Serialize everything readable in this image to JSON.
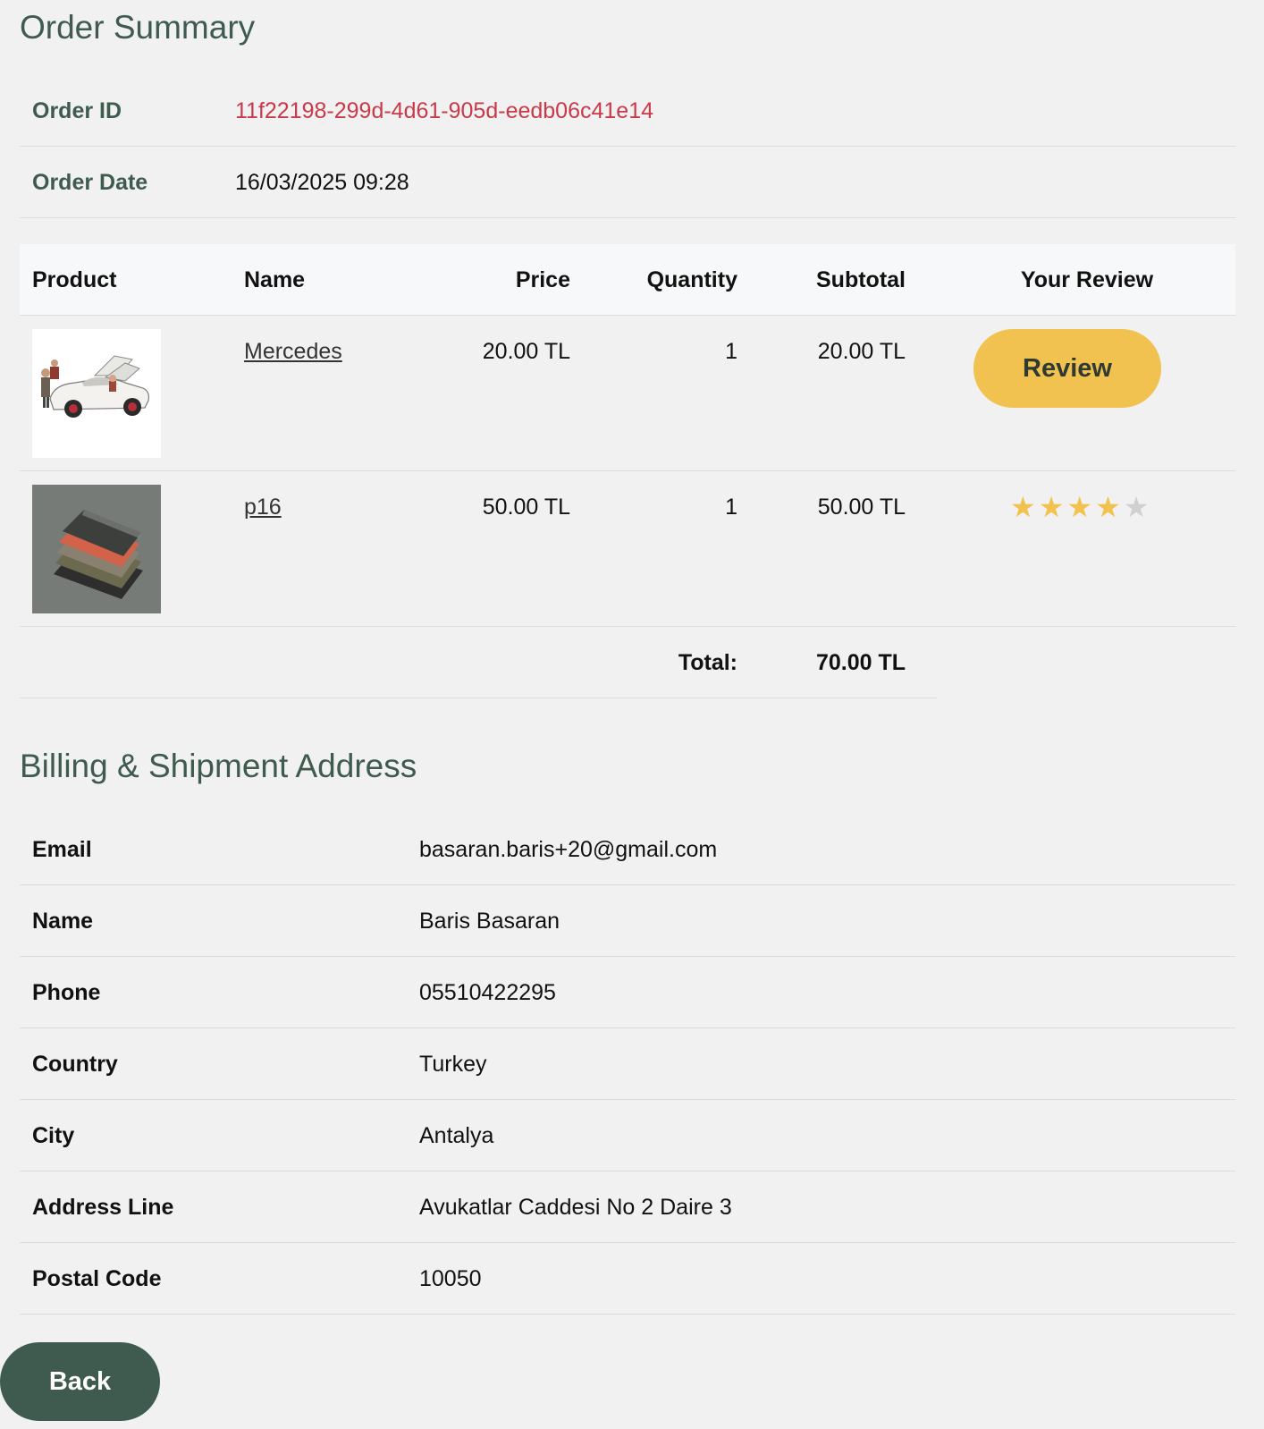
{
  "order_summary": {
    "title": "Order Summary",
    "order_id_label": "Order ID",
    "order_id": "11f22198-299d-4d61-905d-eedb06c41e14",
    "order_date_label": "Order Date",
    "order_date": "16/03/2025 09:28"
  },
  "products_table": {
    "headers": [
      "Product",
      "Name",
      "Price",
      "Quantity",
      "Subtotal",
      "Your Review"
    ],
    "rows": [
      {
        "image": "toy-car-image",
        "name": "Mercedes",
        "price": "20.00 TL",
        "quantity": "1",
        "subtotal": "20.00 TL",
        "review_button": "Review"
      },
      {
        "image": "stacked-wallets-image",
        "name": "p16",
        "price": "50.00 TL",
        "quantity": "1",
        "subtotal": "50.00 TL",
        "rating": 4,
        "rating_max": 5
      }
    ],
    "total_label": "Total:",
    "total_value": "70.00 TL"
  },
  "billing": {
    "title": "Billing & Shipment Address",
    "rows": [
      {
        "label": "Email",
        "value": "basaran.baris+20@gmail.com"
      },
      {
        "label": "Name",
        "value": "Baris Basaran"
      },
      {
        "label": "Phone",
        "value": "05510422295"
      },
      {
        "label": "Country",
        "value": "Turkey"
      },
      {
        "label": "City",
        "value": "Antalya"
      },
      {
        "label": "Address Line",
        "value": "Avukatlar Caddesi No 2 Daire 3"
      },
      {
        "label": "Postal Code",
        "value": "10050"
      }
    ]
  },
  "actions": {
    "back_label": "Back"
  },
  "colors": {
    "accent_green": "#3f5b4f",
    "order_id_red": "#c9394a",
    "review_yellow": "#f1c24f"
  }
}
